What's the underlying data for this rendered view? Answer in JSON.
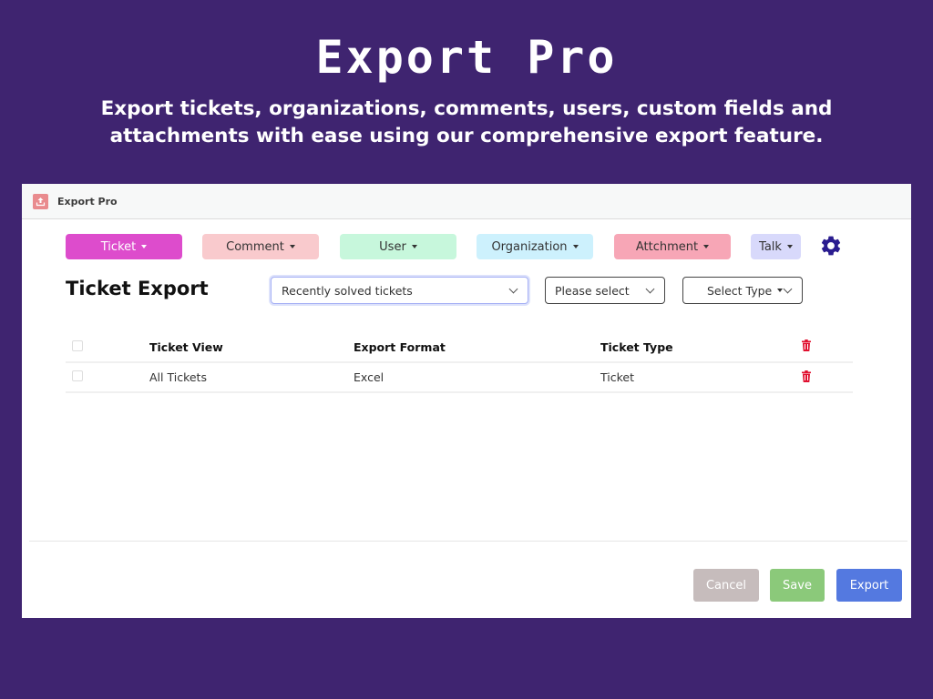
{
  "hero": {
    "title": "Export Pro",
    "subtitle": "Export tickets, organizations, comments, users, custom fields and attachments with ease using our comprehensive export feature."
  },
  "app": {
    "title": "Export Pro",
    "logo_icon": "upload-icon"
  },
  "categories": [
    {
      "label": "Ticket",
      "bg": "#dd4ccc",
      "fg": "#ffffff"
    },
    {
      "label": "Comment",
      "bg": "#f9cacd",
      "fg": "#333333"
    },
    {
      "label": "User",
      "bg": "#c7f7dc",
      "fg": "#333333"
    },
    {
      "label": "Organization",
      "bg": "#cdf1fd",
      "fg": "#333333"
    },
    {
      "label": "Attchment",
      "bg": "#f7a6b6",
      "fg": "#333333"
    },
    {
      "label": "Talk",
      "bg": "#d8d9fb",
      "fg": "#333333"
    }
  ],
  "settings_icon": "gear-icon",
  "settings_color": "#2a1c8f",
  "section": {
    "title": "Ticket Export",
    "view_select": "Recently solved tickets",
    "format_select": "Please select",
    "type_select": "Select Type"
  },
  "table": {
    "headers": [
      "Ticket View",
      "Export Format",
      "Ticket Type"
    ],
    "rows": [
      {
        "view": "All Tickets",
        "format": "Excel",
        "type": "Ticket"
      }
    ],
    "delete_color": "#e0102f"
  },
  "footer": {
    "cancel": "Cancel",
    "save": "Save",
    "export": "Export",
    "cancel_color": "#c6bcbc",
    "save_color": "#8bc97a",
    "export_color": "#5479e0"
  }
}
